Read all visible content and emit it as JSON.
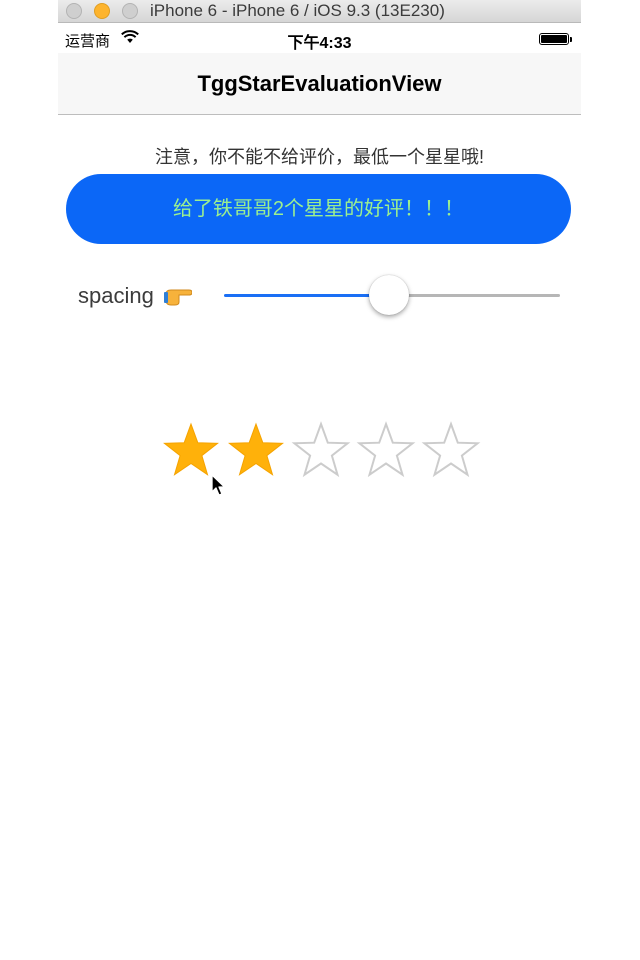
{
  "window": {
    "title": "iPhone 6 - iPhone 6 / iOS 9.3 (13E230)"
  },
  "status_bar": {
    "carrier": "运营商",
    "time": "下午4:33"
  },
  "nav": {
    "title": "TggStarEvaluationView"
  },
  "notice": "注意，你不能不给评价，最低一个星星哦!",
  "rate_button": {
    "label": "给了铁哥哥2个星星的好评！！！"
  },
  "spacing_slider": {
    "label": "spacing",
    "value": 0.49
  },
  "rating": {
    "value": 2,
    "max": 5
  },
  "colors": {
    "button_bg": "#0b67f7",
    "button_text": "#9cf08f",
    "star_filled": "#ffb10a",
    "star_empty": "#cccccc",
    "slider_min_track": "#1a6ff5"
  }
}
